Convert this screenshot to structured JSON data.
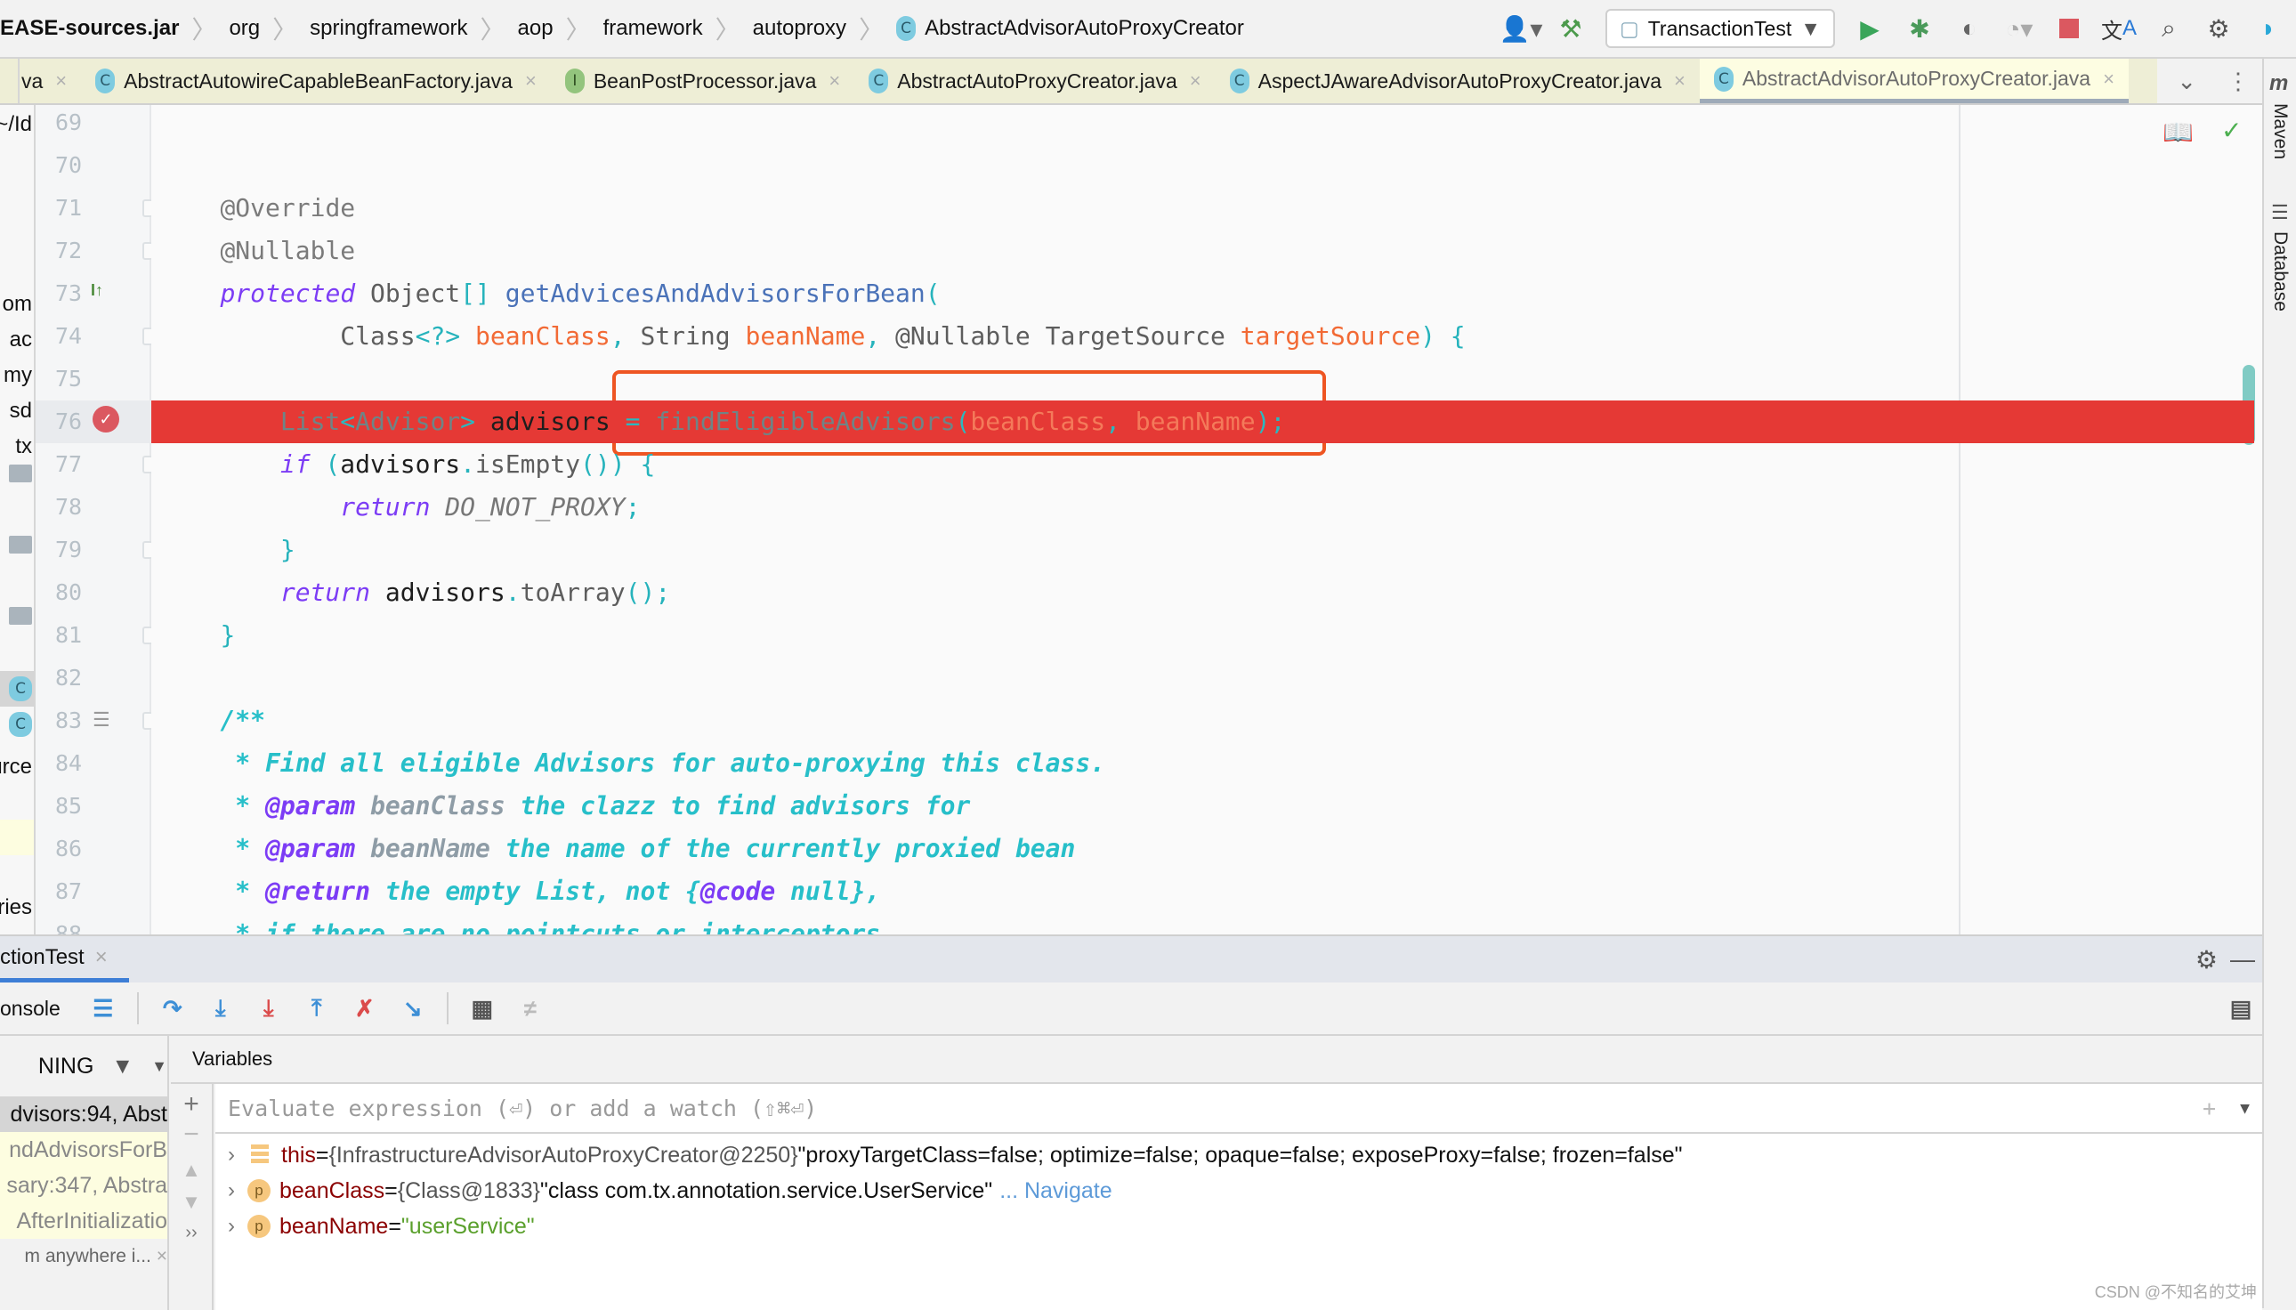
{
  "breadcrumb": [
    "EASE-sources.jar",
    "org",
    "springframework",
    "aop",
    "framework",
    "autoproxy",
    "AbstractAdvisorAutoProxyCreator"
  ],
  "toolbar": {
    "run_config": "TransactionTest"
  },
  "tabs": [
    {
      "label": "va",
      "icon": "none"
    },
    {
      "label": "AbstractAutowireCapableBeanFactory.java",
      "icon": "C"
    },
    {
      "label": "BeanPostProcessor.java",
      "icon": "I"
    },
    {
      "label": "AbstractAutoProxyCreator.java",
      "icon": "C"
    },
    {
      "label": "AspectJAwareAdvisorAutoProxyCreator.java",
      "icon": "C"
    },
    {
      "label": "AbstractAdvisorAutoProxyCreator.java",
      "icon": "C",
      "active": true
    }
  ],
  "left_strip": {
    "items": [
      "~/Id",
      "om",
      "ac",
      "my",
      "sd",
      "tx",
      "urce",
      "ries"
    ]
  },
  "right_strip": {
    "maven": "Maven",
    "database": "Database"
  },
  "editor": {
    "current_line": 76,
    "lines": [
      {
        "n": "69",
        "t": []
      },
      {
        "n": "70",
        "t": []
      },
      {
        "n": "71",
        "t": [
          [
            "    ",
            "pl"
          ],
          [
            "@Override",
            "ann"
          ]
        ]
      },
      {
        "n": "72",
        "t": [
          [
            "    ",
            "pl"
          ],
          [
            "@Nullable",
            "ann"
          ]
        ]
      },
      {
        "n": "73",
        "t": [
          [
            "    ",
            "pl"
          ],
          [
            "protected",
            "kw"
          ],
          [
            " Object",
            "type"
          ],
          [
            "[]",
            "pun"
          ],
          [
            " getAdvicesAndAdvisorsForBean",
            "fn"
          ],
          [
            "(",
            "pun"
          ]
        ]
      },
      {
        "n": "74",
        "t": [
          [
            "            ",
            "pl"
          ],
          [
            "Class",
            "type"
          ],
          [
            "<?>",
            "pun"
          ],
          [
            " ",
            "pl"
          ],
          [
            "beanClass",
            "par"
          ],
          [
            ",",
            "pun"
          ],
          [
            " String ",
            "type"
          ],
          [
            "beanName",
            "par"
          ],
          [
            ",",
            "pun"
          ],
          [
            " @Nullable TargetSource ",
            "type"
          ],
          [
            "targetSource",
            "par"
          ],
          [
            ") {",
            "pun"
          ]
        ]
      },
      {
        "n": "75",
        "t": []
      },
      {
        "n": "76",
        "t": [
          [
            "        ",
            "pl"
          ],
          [
            "List",
            "xg"
          ],
          [
            "<",
            "xt"
          ],
          [
            "Advisor",
            "xg"
          ],
          [
            ">",
            "xt"
          ],
          [
            " advisors ",
            "xd"
          ],
          [
            "=",
            "xt"
          ],
          [
            " findEligibleAdvisors",
            "xg"
          ],
          [
            "(",
            "xt"
          ],
          [
            "beanClass",
            "xp"
          ],
          [
            ",",
            "xt"
          ],
          [
            " beanName",
            "xp"
          ],
          [
            ");",
            "xt"
          ]
        ]
      },
      {
        "n": "77",
        "t": [
          [
            "        ",
            "pl"
          ],
          [
            "if",
            "kw"
          ],
          [
            " (",
            "pun"
          ],
          [
            "advisors",
            "pl"
          ],
          [
            ".",
            "pun"
          ],
          [
            "isEmpty",
            "type"
          ],
          [
            "()) {",
            "pun"
          ]
        ]
      },
      {
        "n": "78",
        "t": [
          [
            "            ",
            "pl"
          ],
          [
            "return",
            "kw"
          ],
          [
            " DO_NOT_PROXY",
            "con"
          ],
          [
            ";",
            "pun"
          ]
        ]
      },
      {
        "n": "79",
        "t": [
          [
            "        ",
            "pl"
          ],
          [
            "}",
            "pun"
          ]
        ]
      },
      {
        "n": "80",
        "t": [
          [
            "        ",
            "pl"
          ],
          [
            "return",
            "kw"
          ],
          [
            " advisors",
            "pl"
          ],
          [
            ".",
            "pun"
          ],
          [
            "toArray",
            "type"
          ],
          [
            "();",
            "pun"
          ]
        ]
      },
      {
        "n": "81",
        "t": [
          [
            "    ",
            "pl"
          ],
          [
            "}",
            "pun"
          ]
        ]
      },
      {
        "n": "82",
        "t": []
      },
      {
        "n": "83",
        "t": [
          [
            "    ",
            "pl"
          ],
          [
            "/**",
            "doc"
          ]
        ]
      },
      {
        "n": "84",
        "t": [
          [
            "     ",
            "pl"
          ],
          [
            "* Find all eligible Advisors for auto-proxying this class.",
            "doc"
          ]
        ]
      },
      {
        "n": "85",
        "t": [
          [
            "     ",
            "pl"
          ],
          [
            "* ",
            "doc"
          ],
          [
            "@param",
            "dtag"
          ],
          [
            " beanClass",
            "dpar"
          ],
          [
            " the clazz to find advisors for",
            "doc"
          ]
        ]
      },
      {
        "n": "86",
        "t": [
          [
            "     ",
            "pl"
          ],
          [
            "* ",
            "doc"
          ],
          [
            "@param",
            "dtag"
          ],
          [
            " beanName",
            "dpar"
          ],
          [
            " the name of the currently proxied bean",
            "doc"
          ]
        ]
      },
      {
        "n": "87",
        "t": [
          [
            "     ",
            "pl"
          ],
          [
            "* ",
            "doc"
          ],
          [
            "@return",
            "dtag"
          ],
          [
            " the empty List, not {",
            "doc"
          ],
          [
            "@code",
            "dtag"
          ],
          [
            " null},",
            "doc"
          ]
        ]
      },
      {
        "n": "88",
        "t": [
          [
            "     ",
            "pl"
          ],
          [
            "* if there are no pointcuts or interceptors",
            "doc"
          ]
        ]
      }
    ]
  },
  "debug": {
    "tab_label": "ctionTest",
    "console_label": "onsole",
    "variables_label": "Variables",
    "eval_placeholder": "Evaluate expression (⏎) or add a watch (⇧⌘⏎)",
    "frames_filter": "NING",
    "frames": [
      {
        "label": "dvisors:94, Abst",
        "state": "selected"
      },
      {
        "label": "ndAdvisorsForB",
        "state": "library"
      },
      {
        "label": "sary:347, Abstra",
        "state": "library"
      },
      {
        "label": "AfterInitializatio",
        "state": "library"
      },
      {
        "label": "m anywhere i...",
        "state": "hint"
      }
    ],
    "variables": [
      {
        "name": "this",
        "icon": "field-list",
        "value": "{InfrastructureAdvisorAutoProxyCreator@2250}",
        "string": " \"proxyTargetClass=false; optimize=false; opaque=false; exposeProxy=false; frozen=false\""
      },
      {
        "name": "beanClass",
        "icon": "p",
        "value": "{Class@1833}",
        "string": " \"class com.tx.annotation.service.UserService\"",
        "link": "... Navigate"
      },
      {
        "name": "beanName",
        "icon": "p",
        "value": "",
        "strval": "\"userService\""
      }
    ]
  },
  "watermark": "CSDN @不知名的艾坤",
  "colors": {
    "execution_line": "#e53935",
    "highlight_box": "#ee5522",
    "active_tab_underline": "#3d7ed6"
  }
}
